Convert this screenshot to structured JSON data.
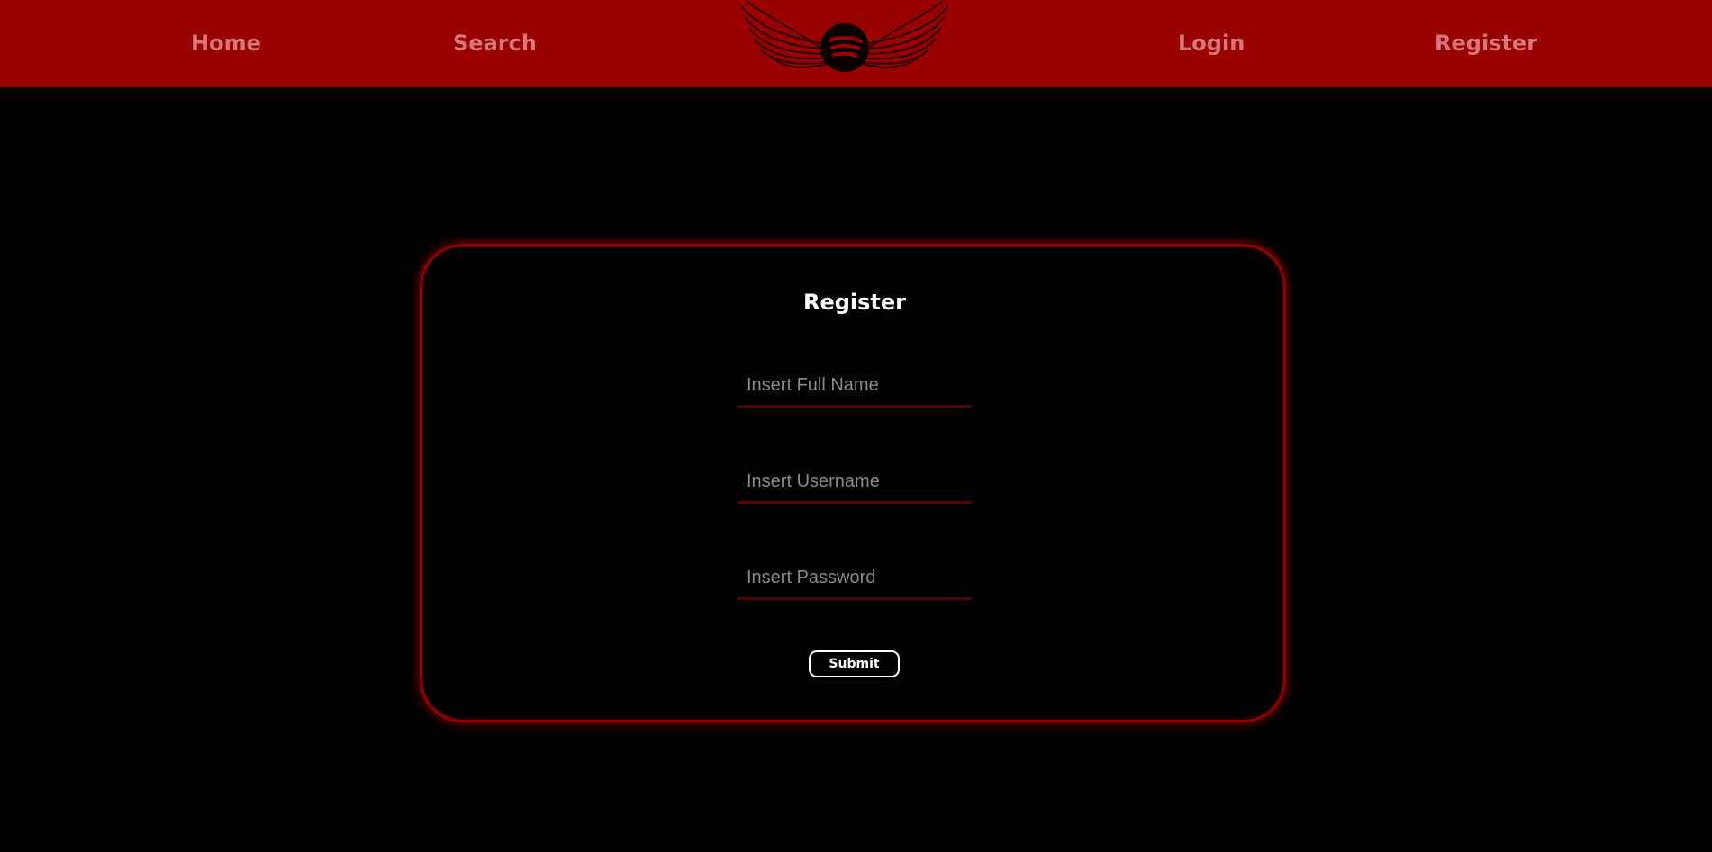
{
  "nav": {
    "home": "Home",
    "search": "Search",
    "login": "Login",
    "register": "Register",
    "logo_icon": "winged-spotify-logo-icon"
  },
  "form": {
    "title": "Register",
    "full_name_placeholder": "Insert Full Name",
    "username_placeholder": "Insert Username",
    "password_placeholder": "Insert Password",
    "submit_label": "Submit"
  },
  "colors": {
    "navbar_bg": "#990000",
    "nav_link": "#d9767a",
    "page_bg": "#000000",
    "card_border": "#8f0000"
  }
}
